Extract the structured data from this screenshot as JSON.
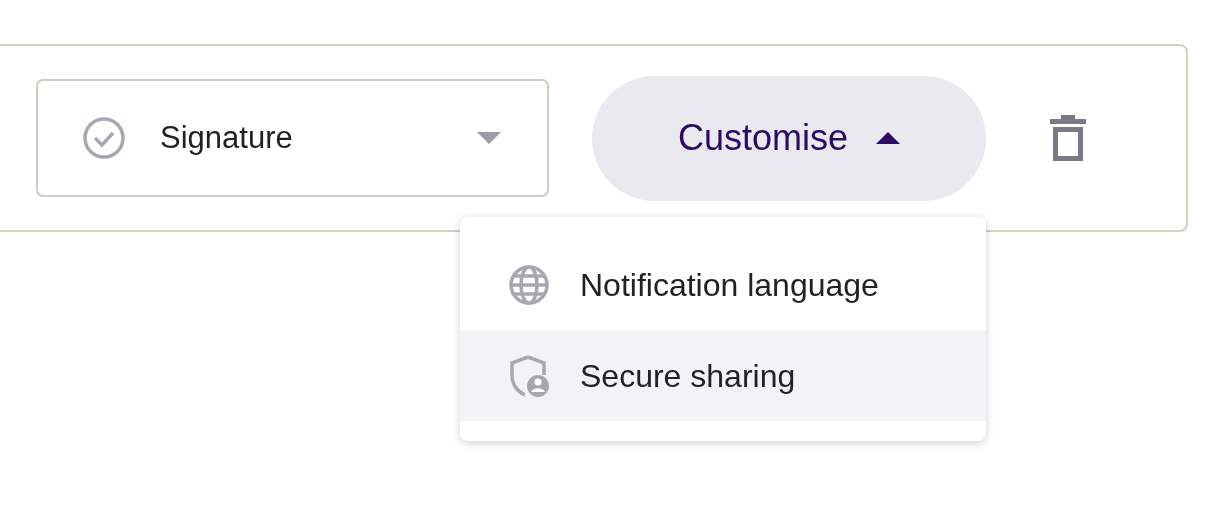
{
  "select": {
    "value": "Signature"
  },
  "customise_button": {
    "label": "Customise",
    "expanded": true
  },
  "menu": {
    "items": [
      {
        "kind": "globe",
        "label": "Notification language",
        "selected": false
      },
      {
        "kind": "shield",
        "label": "Secure sharing",
        "selected": true
      }
    ]
  }
}
